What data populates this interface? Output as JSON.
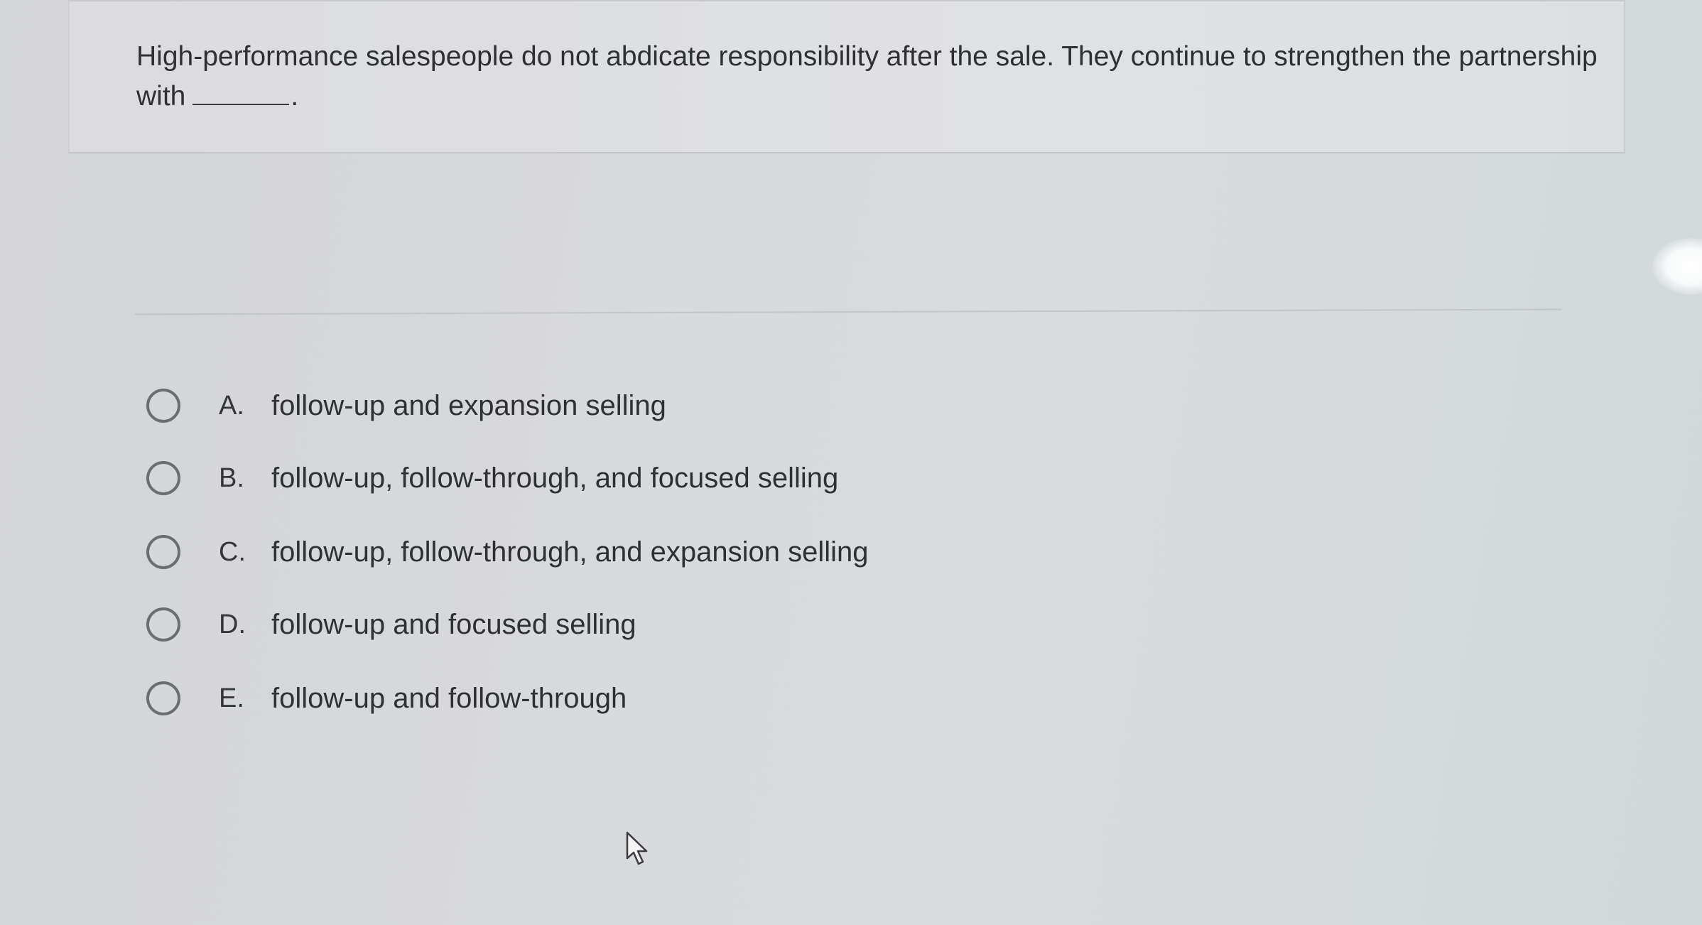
{
  "question": {
    "text_before_blank": "High-performance salespeople do not abdicate responsibility after the sale. They continue to strengthen the partnership with",
    "text_after_blank": "."
  },
  "options": [
    {
      "letter": "A.",
      "text": "follow-up and expansion selling"
    },
    {
      "letter": "B.",
      "text": "follow-up, follow-through, and focused selling"
    },
    {
      "letter": "C.",
      "text": "follow-up, follow-through, and expansion selling"
    },
    {
      "letter": "D.",
      "text": "follow-up and focused selling"
    },
    {
      "letter": "E.",
      "text": "follow-up and follow-through"
    }
  ],
  "icons": {
    "radio": "radio-circle-icon",
    "cursor": "mouse-pointer-icon"
  },
  "colors": {
    "background": "#d6d8da",
    "text": "#2e3034",
    "radio_border": "#6a6d72"
  }
}
